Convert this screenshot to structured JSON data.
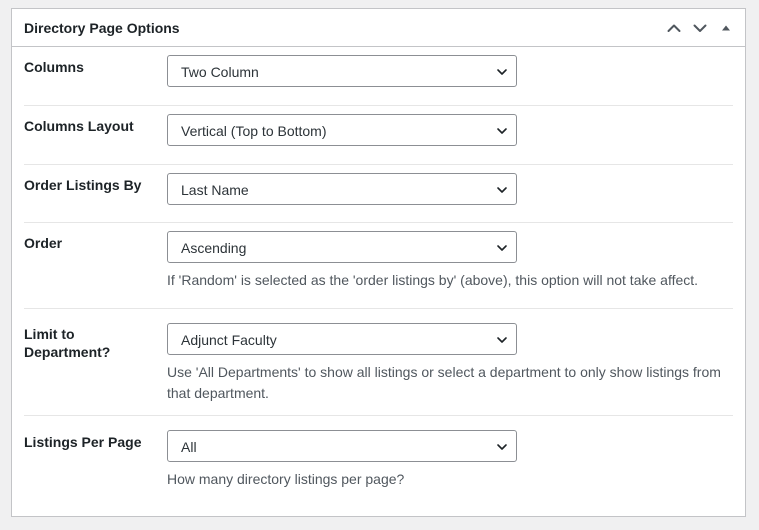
{
  "metabox": {
    "title": "Directory Page Options",
    "controls": {
      "move_up_icon": "chevron-up-icon",
      "move_down_icon": "chevron-down-icon",
      "toggle_icon": "caret-up-icon"
    }
  },
  "options": [
    {
      "label": "Columns",
      "selected": "Two Column",
      "description": ""
    },
    {
      "label": "Columns Layout",
      "selected": "Vertical (Top to Bottom)",
      "description": ""
    },
    {
      "label": "Order Listings By",
      "selected": "Last Name",
      "description": ""
    },
    {
      "label": "Order",
      "selected": "Ascending",
      "description": "If 'Random' is selected as the 'order listings by' (above), this option will not take affect."
    },
    {
      "label": "Limit to Department?",
      "selected": "Adjunct Faculty",
      "description": "Use 'All Departments' to show all listings or select a department to only show listings from that department."
    },
    {
      "label": "Listings Per Page",
      "selected": "All",
      "description": "How many directory listings per page?"
    }
  ],
  "colors": {
    "border": "#c3c4c7",
    "text": "#1d2327",
    "description": "#50575e",
    "background": "#f0f0f1"
  }
}
